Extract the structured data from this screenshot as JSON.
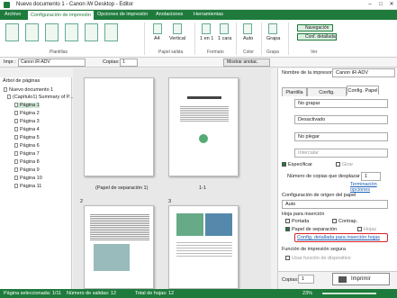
{
  "window": {
    "title": "Nuevo documento 1 - Canon iW Desktop - Editor"
  },
  "menu": [
    "Archivo",
    "Configuración de impresión",
    "Opciones de impresión",
    "Anotaciones",
    "Herramientas"
  ],
  "ribbon": {
    "groups": [
      "Plantillas",
      "Papel salida",
      "Formato",
      "Color",
      "Grapa",
      "Ver"
    ],
    "items": {
      "paper": "A4",
      "orientation": "Vertical",
      "format": "1 en 1",
      "layout": "1 cara",
      "color": "Auto",
      "staple": "Grapa"
    },
    "view_buttons": [
      "Navegación",
      "Conf. detallada"
    ]
  },
  "toolbar": {
    "printer_label": "Impr.:",
    "printer": "Canon iR-ADV",
    "copies_label": "Copias:",
    "copies": "1",
    "show_annot": "Mostrar anotac."
  },
  "left": {
    "title": "Árbol de páginas",
    "items": [
      "Nuevo documento 1",
      "(Capítulo1) Summary of P...",
      "Página 1",
      "Página 2",
      "Página 3",
      "Página 4",
      "Página 5",
      "Página 6",
      "Página 7",
      "Página 8",
      "Página 9",
      "Página 10",
      "Página 11"
    ]
  },
  "center": {
    "page_labels": [
      "(Papel de separación 1)",
      "1-1",
      "2",
      "3"
    ]
  },
  "right": {
    "printer_label": "Nombre de la impresora:",
    "printer": "Canon iR-ADV",
    "tabs": [
      "Plantilla",
      "Config. impresión",
      "Config. Papel"
    ],
    "settings": [
      "No grapar",
      "Desactivado",
      "No plegar",
      "Intercalar"
    ],
    "checkboxes": [
      "Especificar",
      "Girar"
    ],
    "copies_label": "Número de copias que desplazar",
    "copies_value": "1",
    "finish_link": "Terminación opciones",
    "source_label": "Configuración de origen del papel",
    "source_value": "Auto",
    "insert_label": "Hoja para inserción",
    "insert_options": [
      "Portada",
      "Contrap.",
      "Papel de separación",
      "Hojas"
    ],
    "detail_link": "Config. detallada para inserción hojas",
    "secure_label": "Función de impresión segura",
    "secure_option": "Usar función de dispositivo",
    "copies_bottom_label": "Copias:",
    "copies_bottom": "1",
    "print_button": "Imprimir"
  },
  "status": {
    "selected": "Página seleccionada: 1/11",
    "output": "Número de salidas: 12",
    "total": "Total de hojas: 12",
    "zoom": "23%"
  }
}
